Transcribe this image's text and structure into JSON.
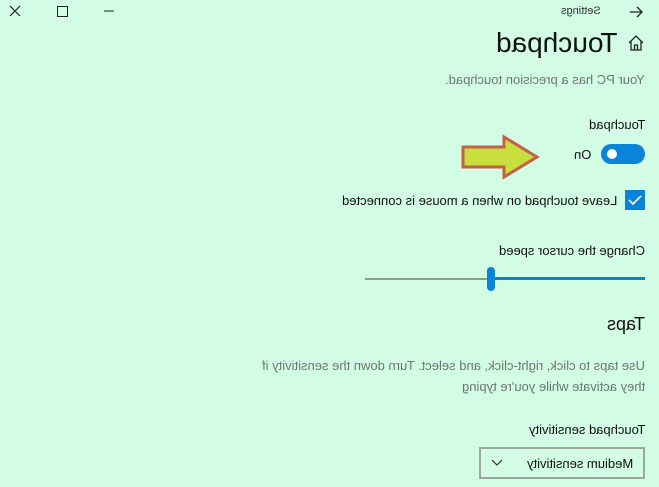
{
  "window": {
    "app_title": "Settings"
  },
  "page": {
    "title": "Touchpad",
    "subtitle": "Your PC has a precision touchpad."
  },
  "touchpad": {
    "label": "Touchpad",
    "toggle_state_text": "On",
    "toggle_on": true
  },
  "mouse_option": {
    "label": "Leave touchpad on when a mouse is connected",
    "checked": true
  },
  "cursor_speed": {
    "label": "Change the cursor speed",
    "value_fraction": 0.55
  },
  "taps": {
    "heading": "Taps",
    "description_line1": "Use taps to click, right-click, and select. Turn down the sensitivity if",
    "description_line2": "they activate while you're typing",
    "sensitivity_label": "Touchpad sensitivity",
    "sensitivity_value": "Medium sensitivity"
  },
  "colors": {
    "background": "#d2fce3",
    "accent": "#0a84d8",
    "annotation_arrow_fill": "#c8de3c",
    "annotation_arrow_stroke": "#c2604a"
  },
  "icons": {
    "back": "back-arrow-icon",
    "home": "home-icon",
    "close": "close-icon",
    "maximize": "maximize-icon",
    "minimize": "minimize-icon",
    "chevron": "chevron-down-icon",
    "check": "checkmark-icon"
  }
}
